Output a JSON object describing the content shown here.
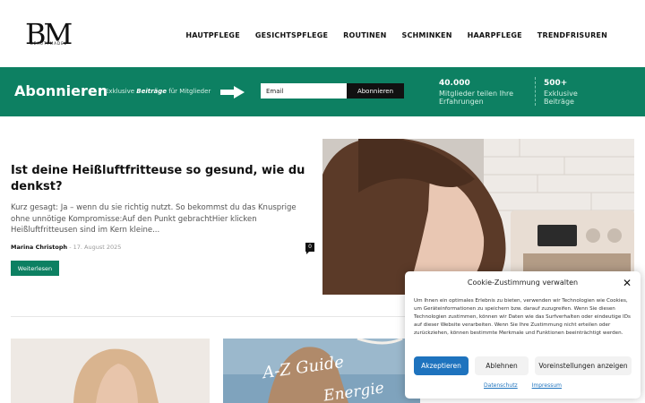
{
  "header": {
    "logo_text": "BM",
    "logo_subtext": "BEAUTYMADEL",
    "nav": [
      "HAUTPFLEGE",
      "GESICHTSPFLEGE",
      "ROUTINEN",
      "SCHMINKEN",
      "HAARPFLEGE",
      "TRENDFRISUREN"
    ]
  },
  "banner": {
    "title": "Abonnieren",
    "subtitle_prefix": "Exklusive ",
    "subtitle_emphasis": "Beiträge",
    "subtitle_suffix": " für Mitglieder",
    "email_placeholder": "Email",
    "subscribe_label": "Abonnieren",
    "stats": [
      {
        "number": "40.000",
        "label": "Mitglieder teilen Ihre Erfahrungen"
      },
      {
        "number": "500+",
        "label": "Exklusive Beiträge"
      }
    ]
  },
  "featured": {
    "title": "Ist deine Heißluftfritteuse so gesund, wie du denkst?",
    "excerpt": "Kurz gesagt: Ja – wenn du sie richtig nutzt. So bekommst du das Knusprige ohne unnötige Kompromisse:Auf den Punkt gebrachtHier klicken Heißluftfritteusen sind im Kern kleine...",
    "author": "Marina Christoph",
    "separator": " - ",
    "date": "17. August 2025",
    "comments": "0",
    "read_more": "Weiterlesen"
  },
  "cards": {
    "card2_line1": "A-Z Guide",
    "card2_line2": "Energie"
  },
  "cookie": {
    "title": "Cookie-Zustimmung verwalten",
    "close": "✕",
    "body": "Um Ihnen ein optimales Erlebnis zu bieten, verwenden wir Technologien wie Cookies, um Geräteinformationen zu speichern bzw. darauf zuzugreifen. Wenn Sie diesen Technologien zustimmen, können wir Daten wie das Surfverhalten oder eindeutige IDs auf dieser Website verarbeiten. Wenn Sie Ihre Zustimmung nicht erteilen oder zurückziehen, können bestimmte Merkmale und Funktionen beeinträchtigt werden.",
    "accept": "Akzeptieren",
    "deny": "Ablehnen",
    "preferences": "Voreinstellungen anzeigen",
    "links": [
      "Datenschutz",
      "Impressum"
    ]
  },
  "colors": {
    "brand_green": "#0d8062",
    "accept_blue": "#1e73be"
  }
}
